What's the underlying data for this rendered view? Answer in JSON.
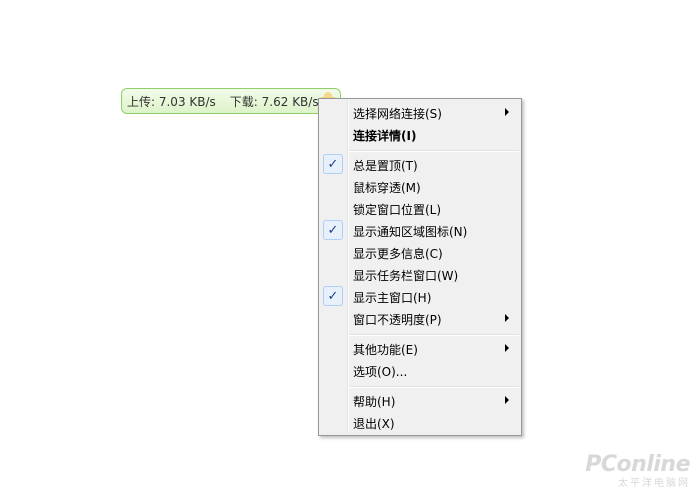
{
  "speed_pill": {
    "upload": "上传: 7.03 KB/s",
    "download": "下载: 7.62 KB/s"
  },
  "menu": {
    "items": [
      {
        "label": "选择网络连接(S)",
        "checked": false,
        "submenu": true,
        "bold": false
      },
      {
        "label": "连接详情(I)",
        "checked": false,
        "submenu": false,
        "bold": true
      },
      {
        "label": "总是置顶(T)",
        "checked": true,
        "submenu": false,
        "bold": false
      },
      {
        "label": "鼠标穿透(M)",
        "checked": false,
        "submenu": false,
        "bold": false
      },
      {
        "label": "锁定窗口位置(L)",
        "checked": false,
        "submenu": false,
        "bold": false
      },
      {
        "label": "显示通知区域图标(N)",
        "checked": true,
        "submenu": false,
        "bold": false
      },
      {
        "label": "显示更多信息(C)",
        "checked": false,
        "submenu": false,
        "bold": false
      },
      {
        "label": "显示任务栏窗口(W)",
        "checked": false,
        "submenu": false,
        "bold": false
      },
      {
        "label": "显示主窗口(H)",
        "checked": true,
        "submenu": false,
        "bold": false
      },
      {
        "label": "窗口不透明度(P)",
        "checked": false,
        "submenu": true,
        "bold": false
      },
      {
        "label": "其他功能(E)",
        "checked": false,
        "submenu": true,
        "bold": false
      },
      {
        "label": "选项(O)...",
        "checked": false,
        "submenu": false,
        "bold": false
      },
      {
        "label": "帮助(H)",
        "checked": false,
        "submenu": true,
        "bold": false
      },
      {
        "label": "退出(X)",
        "checked": false,
        "submenu": false,
        "bold": false
      }
    ],
    "check_glyph": "✓"
  },
  "watermark": {
    "brand": "PConline",
    "sub": "太平洋电脑网"
  },
  "colors": {
    "pill_border": "#8fcf6a",
    "pill_fill": "#ddf3c9",
    "menu_bg": "#f0f0f0",
    "check_highlight": "#e7f0fb",
    "check_border": "#aecff7"
  }
}
